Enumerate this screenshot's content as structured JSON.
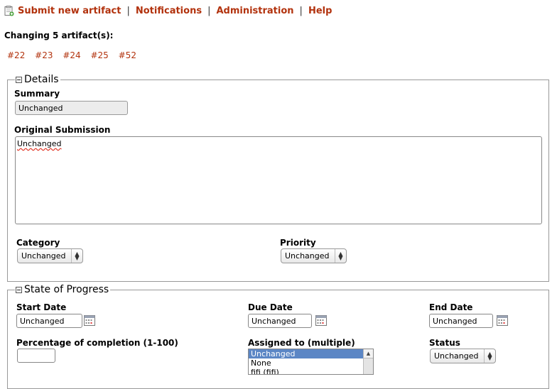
{
  "nav": {
    "items": [
      "Submit new artifact",
      "Notifications",
      "Administration",
      "Help"
    ],
    "separator": "|"
  },
  "changing_label": "Changing 5 artifact(s):",
  "artifact_links": [
    "#22",
    "#23",
    "#24",
    "#25",
    "#52"
  ],
  "details": {
    "legend": "Details",
    "summary_label": "Summary",
    "summary_value": "Unchanged",
    "original_label": "Original Submission",
    "original_value": "Unchanged",
    "category_label": "Category",
    "category_value": "Unchanged",
    "priority_label": "Priority",
    "priority_value": "Unchanged"
  },
  "progress": {
    "legend": "State of Progress",
    "start_label": "Start Date",
    "start_value": "Unchanged",
    "due_label": "Due Date",
    "due_value": "Unchanged",
    "end_label": "End Date",
    "end_value": "Unchanged",
    "percent_label": "Percentage of completion (1-100)",
    "percent_value": "",
    "assigned_label": "Assigned to (multiple)",
    "assigned_options": [
      "Unchanged",
      "None",
      "fifi (fifi)"
    ],
    "status_label": "Status",
    "status_value": "Unchanged"
  },
  "colors": {
    "link": "#b2320d",
    "selected_option": "#5b86c5"
  },
  "icons": {
    "submit": "new-document-icon",
    "calendar": "calendar-icon",
    "collapse": "collapse-toggle-icon"
  }
}
